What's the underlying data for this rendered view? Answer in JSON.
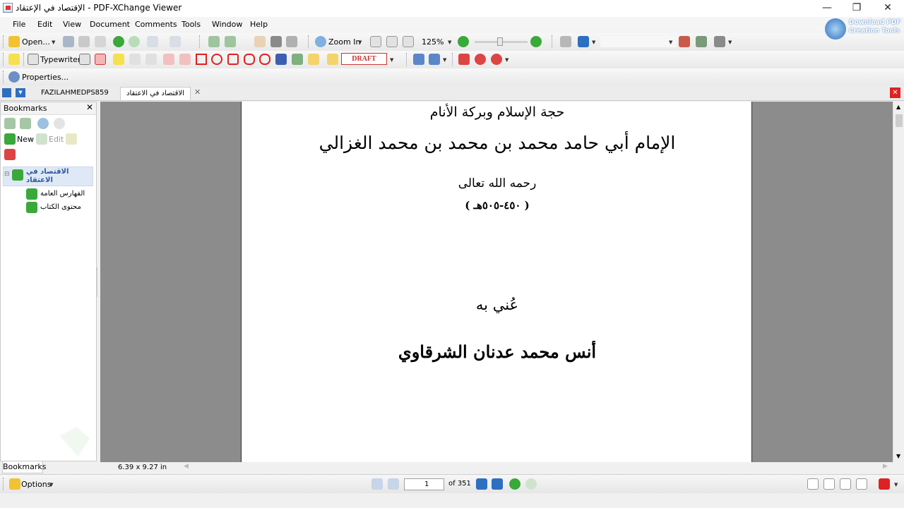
{
  "window": {
    "title": "الإقتصاد في الإعتقاد - PDF-XChange Viewer",
    "controls": {
      "minimize": "—",
      "restore": "❐",
      "close": "✕"
    }
  },
  "menu": [
    "File",
    "Edit",
    "View",
    "Document",
    "Comments",
    "Tools",
    "Window",
    "Help"
  ],
  "toolbar": {
    "open_label": "Open...",
    "zoom_in_label": "Zoom In",
    "zoom_value": "125%",
    "typewriter_label": "Typewriter",
    "draft_stamp": "DRAFT",
    "properties_label": "Properties..."
  },
  "promo": {
    "line1": "Download PDF",
    "line2": "Creation Tools"
  },
  "tabs": [
    {
      "label": "FAZILAHMEDPS859",
      "active": false
    },
    {
      "label": "الاقتصاد في الاعتقاد",
      "active": true
    }
  ],
  "bookmarks": {
    "title": "Bookmarks",
    "new_label": "New",
    "edit_label": "Edit",
    "root": "الاقتصاد في الاعتقاد",
    "children": [
      "الفهارس العامة",
      "محتوى الكتاب"
    ],
    "tab_label": "Bookmarks"
  },
  "page": {
    "line1": "حجة الإسلام وبركة الأنام",
    "line2": "الإمام أبي حامد محمد بن محمد بن محمد الغزالي",
    "line3": "رحمه الله تعالى",
    "line4": "( ٤٥٠-٥٠٥هـ )",
    "line5": "عُني به",
    "line6": "أنس محمد عدنان الشرقاوي"
  },
  "status": {
    "page_size": "6.39 x 9.27 in",
    "options_label": "Options",
    "current_page": "1",
    "page_count": "of 351"
  },
  "colors": {
    "green": "#3aa83a",
    "red": "#d22",
    "accent": "#2d6fc0"
  }
}
